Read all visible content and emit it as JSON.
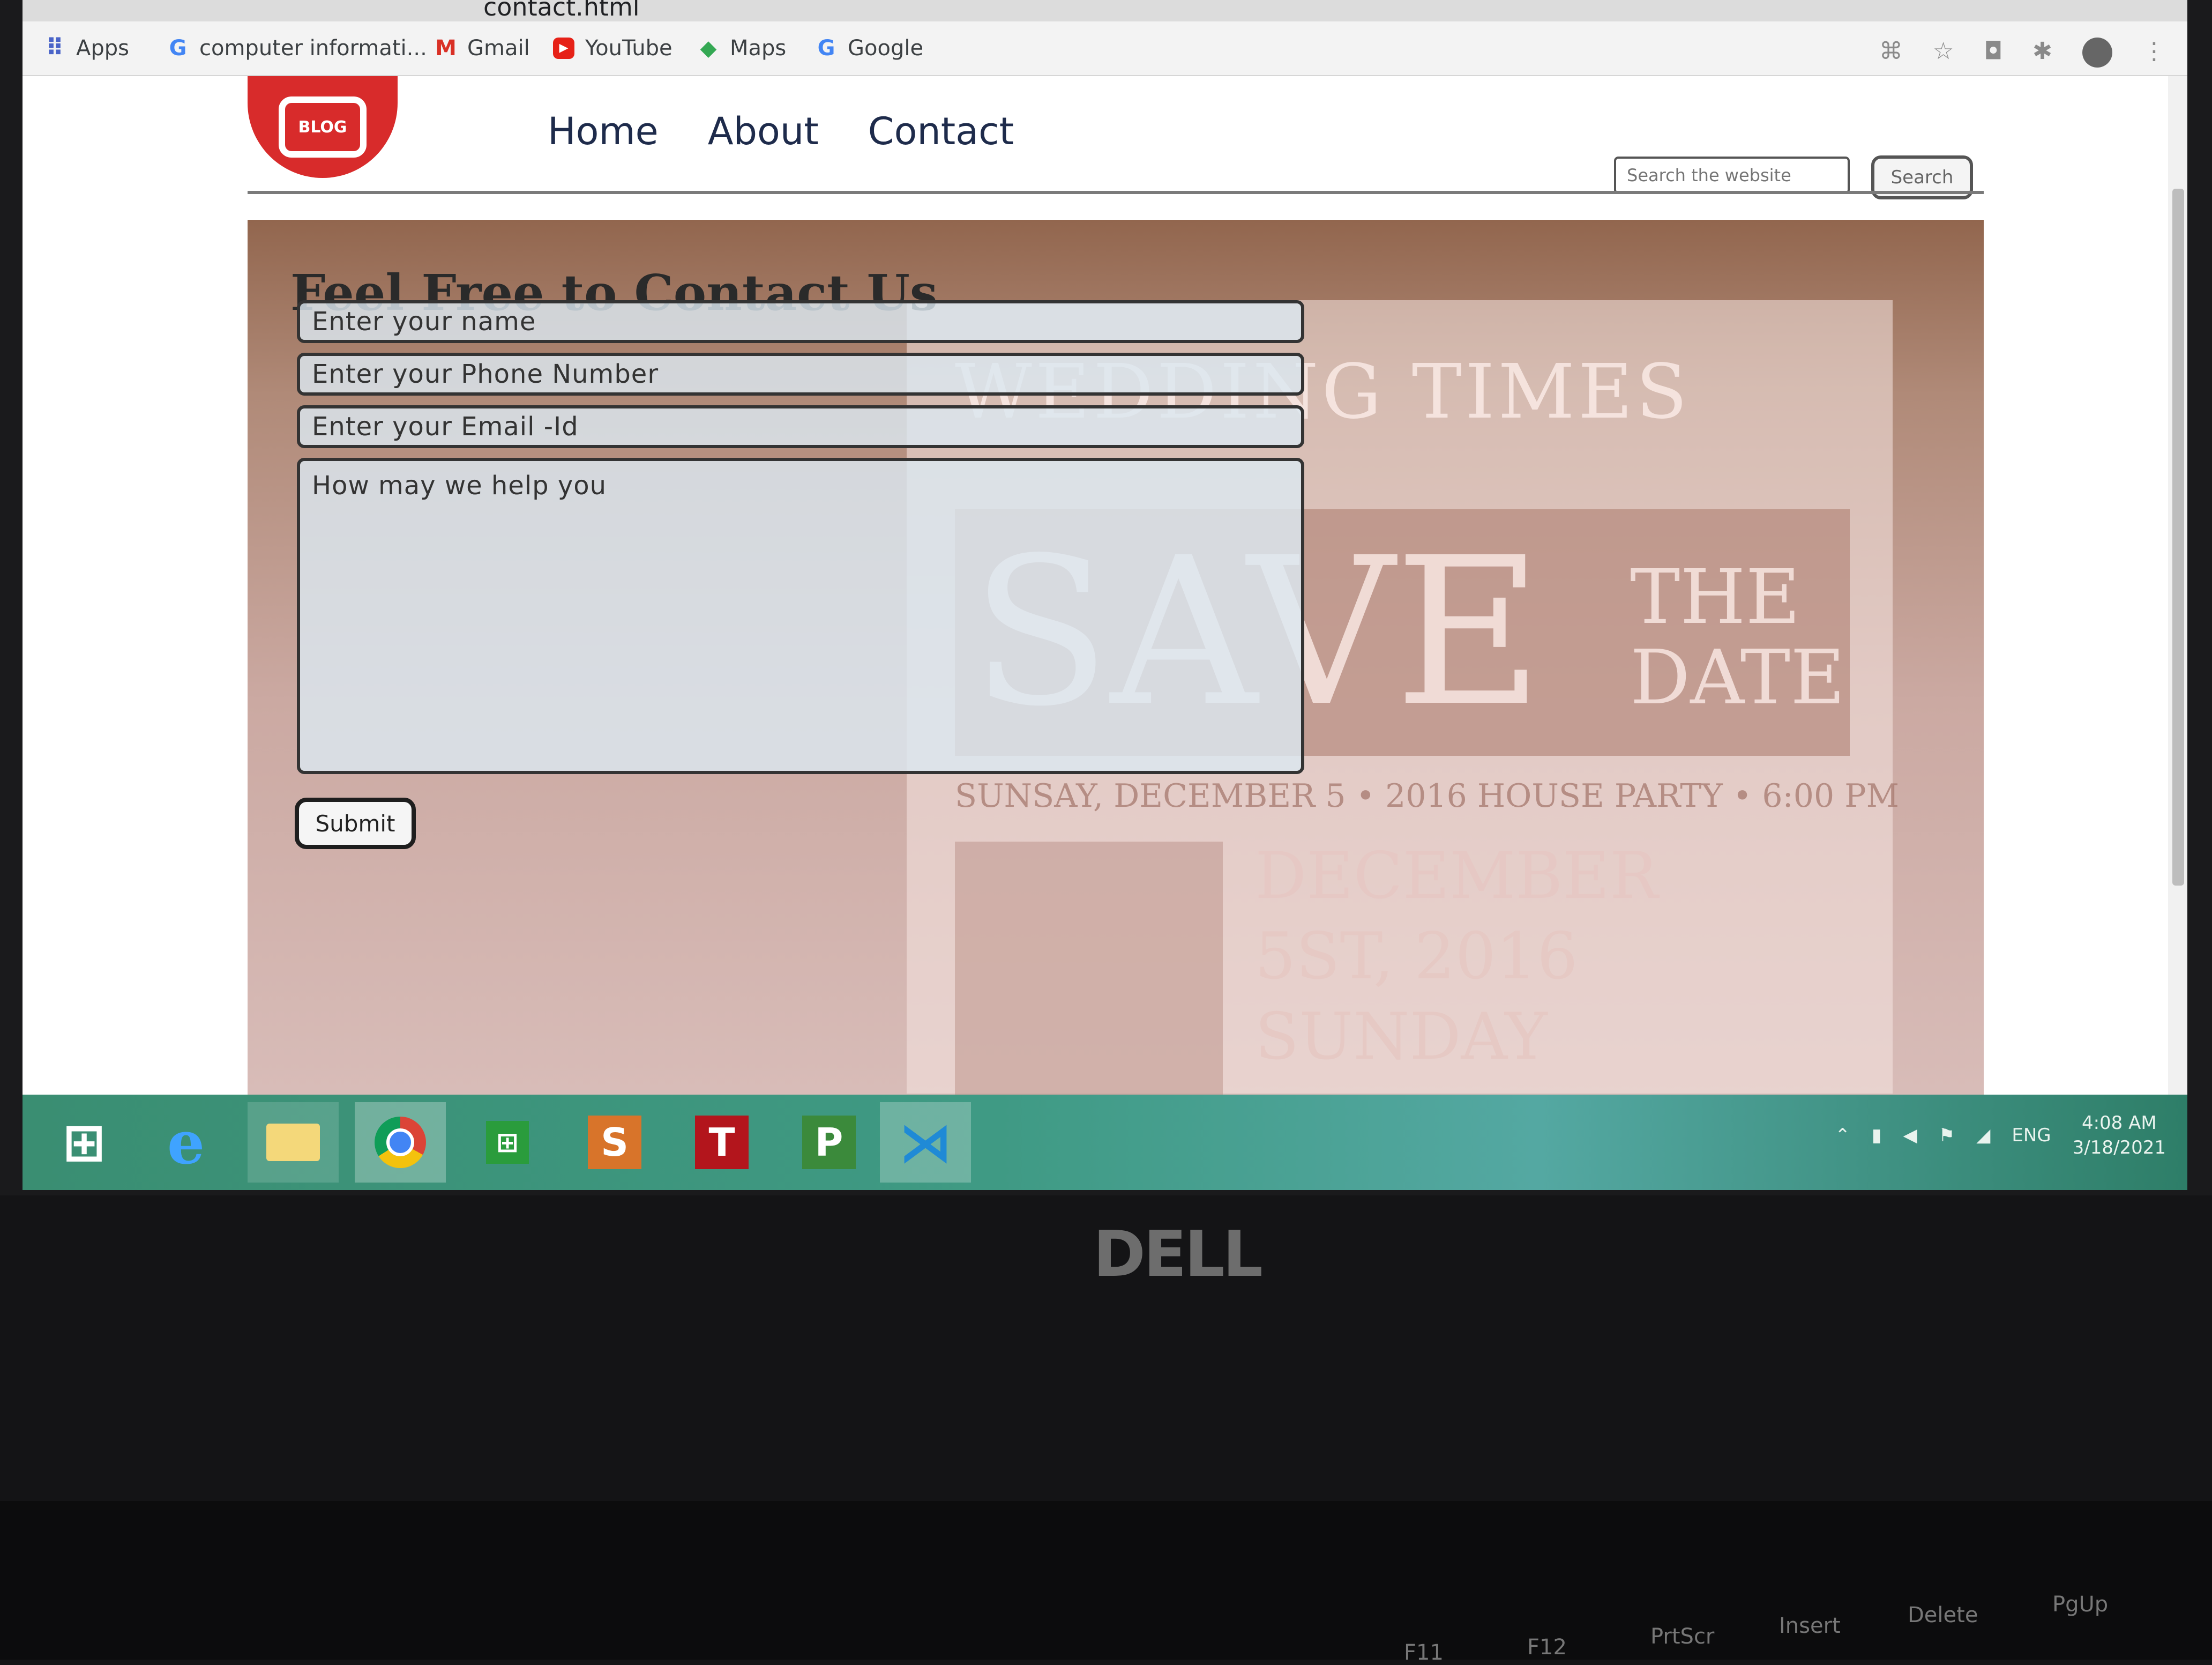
{
  "browser": {
    "url_fragment": "contact.html",
    "bookmarks": [
      {
        "label": "Apps",
        "icon": "apps-grid-icon"
      },
      {
        "label": "computer informati...",
        "icon": "google-g-icon"
      },
      {
        "label": "Gmail",
        "icon": "gmail-icon"
      },
      {
        "label": "YouTube",
        "icon": "youtube-icon"
      },
      {
        "label": "Maps",
        "icon": "maps-icon"
      },
      {
        "label": "Google",
        "icon": "google-g-icon"
      }
    ]
  },
  "site": {
    "logo_text": "BLOG",
    "nav": [
      "Home",
      "About",
      "Contact"
    ],
    "search_placeholder": "Search the website",
    "search_button": "Search"
  },
  "contact": {
    "title": "Feel Free to Contact Us",
    "name_placeholder": "Enter your name",
    "phone_placeholder": "Enter your Phone Number",
    "email_placeholder": "Enter your Email -Id",
    "message_placeholder": "How may we help you",
    "submit_label": "Submit"
  },
  "background_art": {
    "title": "WEDDING TIMES",
    "save": "SAVE",
    "the": "THE",
    "date": "DATE",
    "event_line": "SUNSAY, DECEMBER 5  •  2016 HOUSE PARTY  •  6:00 PM",
    "big_date": [
      "DECEMBER",
      "5ST, 2016",
      "SUNDAY"
    ]
  },
  "taskbar": {
    "language": "ENG",
    "time": "4:08 AM",
    "date": "3/18/2021"
  },
  "device": {
    "brand": "DELL",
    "keys": [
      "F11",
      "F12",
      "PrtScr",
      "Insert",
      "Delete",
      "PgUp"
    ]
  },
  "colors": {
    "logo_red": "#d82b2b",
    "nav_text": "#1e2b4b",
    "taskbar": "#3f9a84"
  }
}
